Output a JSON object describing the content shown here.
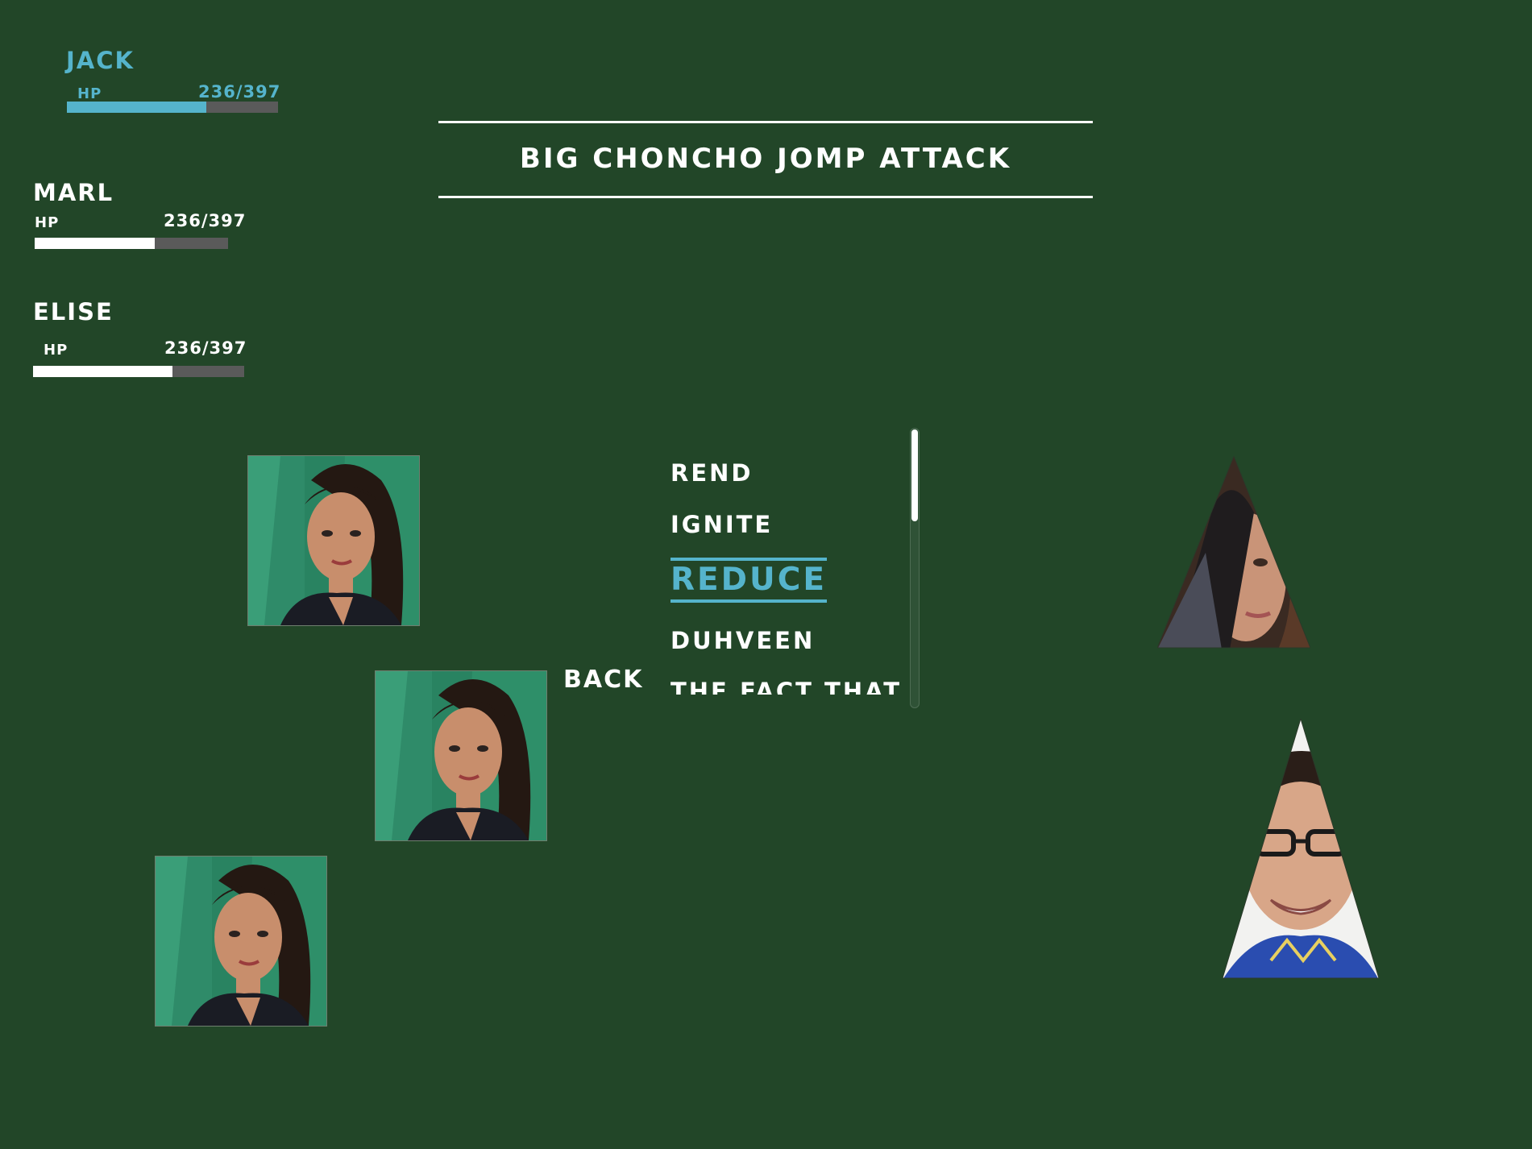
{
  "party": [
    {
      "name": "JACK",
      "hp_label": "HP",
      "hp_text": "236/397",
      "hp_fraction": 0.66,
      "active": true
    },
    {
      "name": "MARL",
      "hp_label": "HP",
      "hp_text": "236/397",
      "hp_fraction": 0.62,
      "active": false
    },
    {
      "name": "ELISE",
      "hp_label": "HP",
      "hp_text": "236/397",
      "hp_fraction": 0.66,
      "active": false
    }
  ],
  "action_banner": {
    "text": "BIG CHONCHO JOMP ATTACK"
  },
  "menu": {
    "back_label": "BACK",
    "skills": [
      "REND",
      "IGNITE",
      "REDUCE",
      "DUHVEEN",
      "THE FACT THAT"
    ],
    "selected_skill": "REDUCE",
    "scroll_fraction": 0.0
  },
  "colors": {
    "background": "#224628",
    "accent": "#55b4cc",
    "text": "#ffffff",
    "bar_empty": "#5a5a5a"
  },
  "icons": {
    "party_portrait": "woman-with-dark-hair-portrait",
    "enemy_1": "woman-face-triangle-portrait",
    "enemy_2": "woman-with-glasses-triangle-portrait"
  }
}
